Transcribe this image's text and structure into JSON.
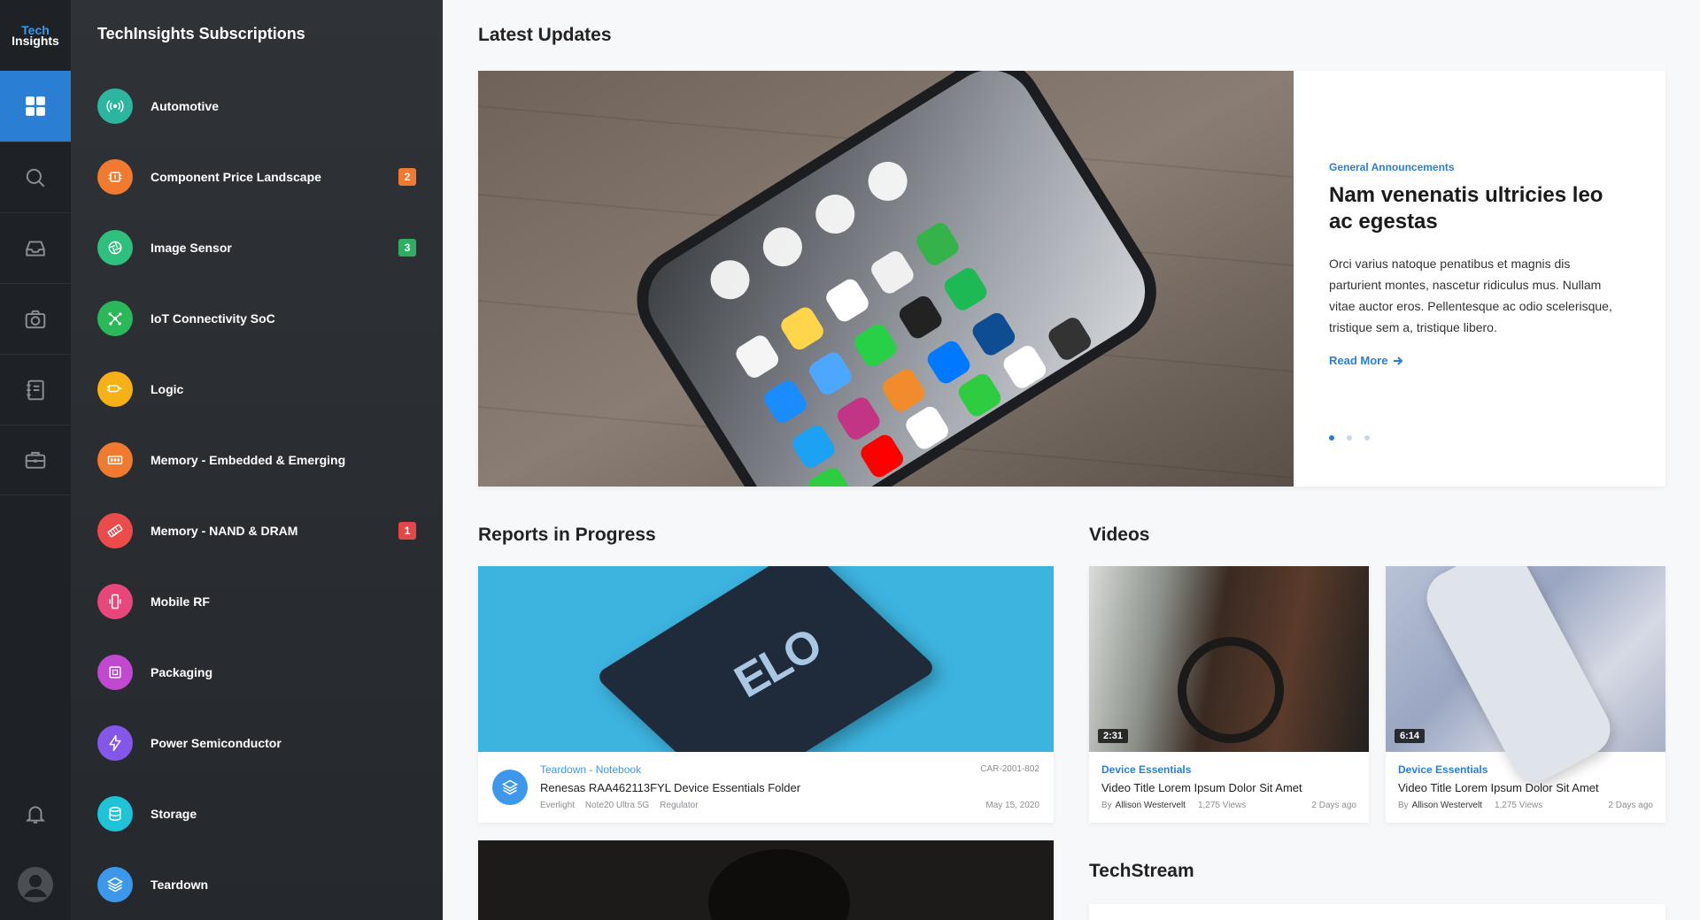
{
  "logo": {
    "line1": "Tech",
    "line2": "Insights"
  },
  "rail": {
    "items": [
      {
        "name": "dashboard",
        "active": true
      },
      {
        "name": "search"
      },
      {
        "name": "inbox"
      },
      {
        "name": "camera"
      },
      {
        "name": "notebook"
      },
      {
        "name": "briefcase"
      },
      {
        "name": "bell"
      },
      {
        "name": "avatar"
      }
    ]
  },
  "panel": {
    "title": "TechInsights Subscriptions",
    "items": [
      {
        "label": "Automotive",
        "color": "#2db5a0",
        "icon": "broadcast-icon",
        "badge": ""
      },
      {
        "label": "Component Price Landscape",
        "color": "#f07a2f",
        "icon": "chip-icon",
        "badge": "2",
        "badge_color": "#f07a2f"
      },
      {
        "label": "Image Sensor",
        "color": "#2fbf7f",
        "icon": "aperture-icon",
        "badge": "3",
        "badge_color": "#2fae62"
      },
      {
        "label": "IoT Connectivity SoC",
        "color": "#2bb85a",
        "icon": "network-icon",
        "badge": ""
      },
      {
        "label": "Logic",
        "color": "#f5b116",
        "icon": "logic-icon",
        "badge": ""
      },
      {
        "label": "Memory - Embedded & Emerging",
        "color": "#f07a2f",
        "icon": "memory-icon",
        "badge": ""
      },
      {
        "label": "Memory - NAND & DRAM",
        "color": "#ec4b4b",
        "icon": "ram-icon",
        "badge": "1",
        "badge_color": "#e54747"
      },
      {
        "label": "Mobile RF",
        "color": "#e8477c",
        "icon": "mobile-icon",
        "badge": ""
      },
      {
        "label": "Packaging",
        "color": "#c149cf",
        "icon": "package-icon",
        "badge": ""
      },
      {
        "label": "Power Semiconductor",
        "color": "#8457e8",
        "icon": "lightning-icon",
        "badge": ""
      },
      {
        "label": "Storage",
        "color": "#1ec3d8",
        "icon": "database-icon",
        "badge": ""
      },
      {
        "label": "Teardown",
        "color": "#3d97ea",
        "icon": "layers-icon",
        "badge": ""
      }
    ]
  },
  "main": {
    "latest_title": "Latest Updates",
    "hero": {
      "category": "General Announcements",
      "headline": "Nam venenatis ultricies leo ac egestas",
      "body": "Orci varius natoque penatibus et magnis dis parturient montes, nascetur ridiculus mus. Nullam vitae auctor eros. Pellentesque ac odio scelerisque, tristique sem a, tristique libero.",
      "read_more": "Read More",
      "slides": 3,
      "active_slide": 0
    },
    "reports_title": "Reports in Progress",
    "report": {
      "category": "Teardown - Notebook",
      "code": "CAR-2001-802",
      "title": "Renesas RAA462113FYL Device Essentials Folder",
      "tags": [
        "Everlight",
        "Note20 Ultra 5G",
        "Regulator"
      ],
      "date": "May 15, 2020",
      "image_text": "ELO"
    },
    "videos_title": "Videos",
    "videos": [
      {
        "duration": "2:31",
        "category": "Device Essentials",
        "title": "Video Title Lorem Ipsum Dolor Sit Amet",
        "by": "By",
        "author": "Allison Westervelt",
        "views": "1,275 Views",
        "ago": "2 Days ago"
      },
      {
        "duration": "6:14",
        "category": "Device Essentials",
        "title": "Video Title Lorem Ipsum Dolor Sit Amet",
        "by": "By",
        "author": "Allison Westervelt",
        "views": "1,275 Views",
        "ago": "2 Days ago"
      }
    ],
    "techstream_title": "TechStream"
  }
}
